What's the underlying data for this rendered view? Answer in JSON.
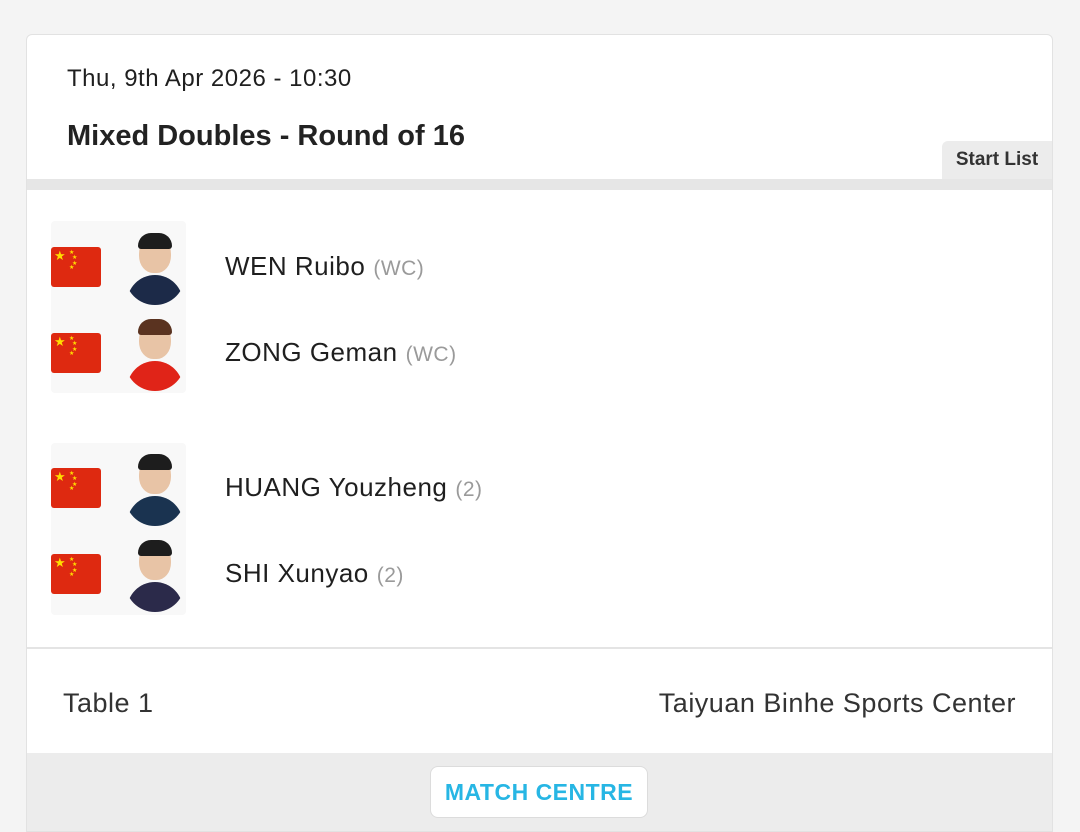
{
  "match": {
    "datetime": "Thu, 9th Apr 2026 - 10:30",
    "title": "Mixed Doubles - Round of 16",
    "start_list_label": "Start List"
  },
  "teams": [
    {
      "players": [
        {
          "name": "WEN Ruibo",
          "seed": "(WC)",
          "flag": "china-flag",
          "shirt_color": "#1c2a48"
        },
        {
          "name": "ZONG Geman",
          "seed": "(WC)",
          "flag": "china-flag",
          "shirt_color": "#e02418"
        }
      ]
    },
    {
      "players": [
        {
          "name": "HUANG Youzheng",
          "seed": "(2)",
          "flag": "china-flag",
          "shirt_color": "#1a3350"
        },
        {
          "name": "SHI Xunyao",
          "seed": "(2)",
          "flag": "china-flag",
          "shirt_color": "#2b2a4a"
        }
      ]
    }
  ],
  "footer": {
    "table": "Table 1",
    "venue": "Taiyuan Binhe Sports Center",
    "match_centre_label": "MATCH CENTRE"
  },
  "colors": {
    "accent": "#27b6e4",
    "flag_red": "#de2910",
    "flag_yellow": "#ffde00"
  }
}
